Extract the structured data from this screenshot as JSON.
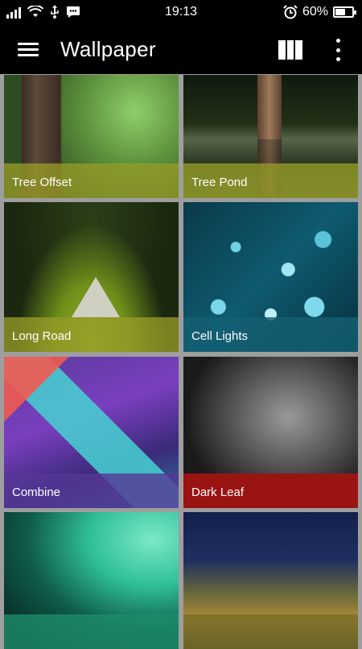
{
  "status_bar": {
    "time": "19:13",
    "battery_percent": "60%",
    "battery_level": 0.6,
    "icons": [
      "signal-icon",
      "wifi-icon",
      "usb-icon",
      "messenger-icon",
      "alarm-icon",
      "battery-icon"
    ]
  },
  "app_bar": {
    "title": "Wallpaper",
    "icons": [
      "menu-icon",
      "grid-view-icon",
      "more-vert-icon"
    ]
  },
  "wallpapers": [
    {
      "label": "Tree Offset",
      "label_color": "#969b28"
    },
    {
      "label": "Tree Pond",
      "label_color": "#969b28"
    },
    {
      "label": "Long Road",
      "label_color": "#969b28"
    },
    {
      "label": "Cell Lights",
      "label_color": "#145f73"
    },
    {
      "label": "Combine",
      "label_color": "#553796"
    },
    {
      "label": "Dark Leaf",
      "label_color": "#9b1414"
    },
    {
      "label": "",
      "label_color": "#1e8c69"
    },
    {
      "label": "",
      "label_color": "#786e28"
    }
  ]
}
